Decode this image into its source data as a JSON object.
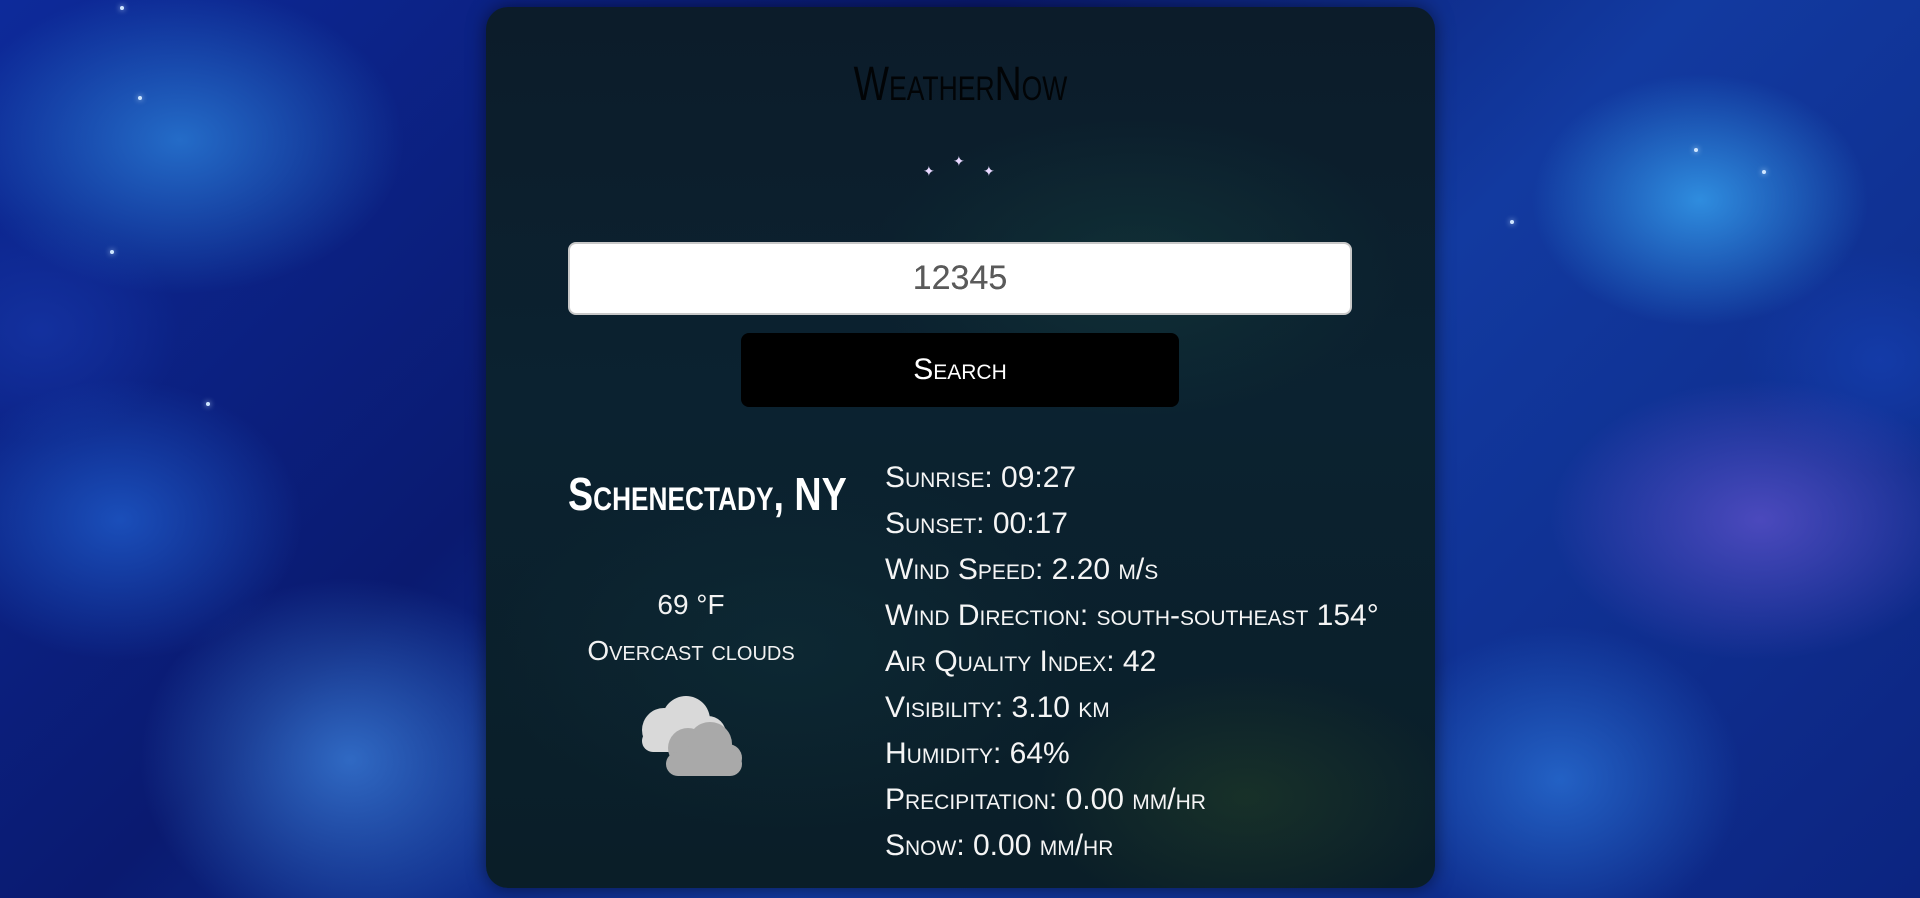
{
  "app": {
    "title": "WeatherNow",
    "sparkle_icon": "sparkles-icon"
  },
  "search": {
    "value": "12345",
    "button_label": "Search"
  },
  "location": {
    "city": "Schenectady, NY",
    "temperature": "69 °F",
    "condition": "Overcast clouds",
    "condition_icon": "cloud-icon"
  },
  "details": [
    {
      "label": "Sunrise: 09:27"
    },
    {
      "label": "Sunset: 00:17"
    },
    {
      "label": "Wind Speed: 2.20 m/s"
    },
    {
      "label": "Wind Direction: south-southeast 154°"
    },
    {
      "label": "Air Quality Index: 42"
    },
    {
      "label": "Visibility: 3.10 km"
    },
    {
      "label": "Humidity: 64%"
    },
    {
      "label": "Precipitation: 0.00 mm/hr"
    },
    {
      "label": "Snow: 0.00 mm/hr"
    }
  ],
  "colors": {
    "panel": "#0b2230",
    "button": "#000000",
    "text": "#ffffff"
  }
}
